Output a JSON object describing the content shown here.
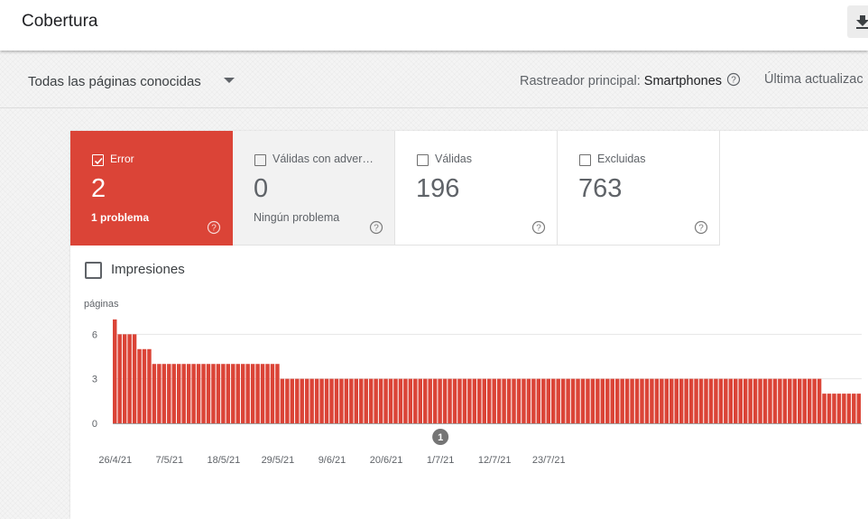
{
  "header": {
    "title": "Cobertura"
  },
  "filter": {
    "selected": "Todas las páginas conocidas",
    "crawler_label": "Rastreador principal:",
    "crawler_value": "Smartphones",
    "last_update": "Última actualizac"
  },
  "cards": [
    {
      "label": "Error",
      "count": "2",
      "sub": "1 problema",
      "checked": true
    },
    {
      "label": "Válidas con adver…",
      "count": "0",
      "sub": "Ningún problema",
      "checked": false
    },
    {
      "label": "Válidas",
      "count": "196",
      "sub": "",
      "checked": false
    },
    {
      "label": "Excluidas",
      "count": "763",
      "sub": "",
      "checked": false
    }
  ],
  "impressions": {
    "label": "Impresiones"
  },
  "chart_data": {
    "type": "bar",
    "ylabel": "páginas",
    "yticks": [
      0,
      3,
      6,
      9
    ],
    "ylim": [
      0,
      9
    ],
    "grid": true,
    "color": "#db4437",
    "xtick_labels": [
      "26/4/21",
      "7/5/21",
      "18/5/21",
      "29/5/21",
      "9/6/21",
      "20/6/21",
      "1/7/21",
      "12/7/21",
      "23/7/21"
    ],
    "xtick_index": [
      0,
      11,
      22,
      33,
      44,
      55,
      66,
      77,
      88
    ],
    "annotation": {
      "label": "1",
      "index": 66
    },
    "values": [
      7,
      6,
      6,
      6,
      6,
      5,
      5,
      5,
      4,
      4,
      4,
      4,
      4,
      4,
      4,
      4,
      4,
      4,
      4,
      4,
      4,
      4,
      4,
      4,
      4,
      4,
      4,
      4,
      4,
      4,
      4,
      4,
      4,
      4,
      3,
      3,
      3,
      3,
      3,
      3,
      3,
      3,
      3,
      3,
      3,
      3,
      3,
      3,
      3,
      3,
      3,
      3,
      3,
      3,
      3,
      3,
      3,
      3,
      3,
      3,
      3,
      3,
      3,
      3,
      3,
      3,
      3,
      3,
      3,
      3,
      3,
      3,
      3,
      3,
      3,
      3,
      3,
      3,
      3,
      3,
      3,
      3,
      3,
      3,
      3,
      3,
      3,
      3,
      3,
      3,
      3,
      3,
      3,
      3,
      3,
      3,
      3,
      3,
      3,
      3,
      3,
      3,
      3,
      3,
      3,
      3,
      3,
      3,
      3,
      3,
      3,
      3,
      3,
      3,
      3,
      3,
      3,
      3,
      3,
      3,
      3,
      3,
      3,
      3,
      3,
      3,
      3,
      3,
      3,
      3,
      3,
      3,
      3,
      3,
      3,
      3,
      3,
      3,
      3,
      3,
      3,
      3,
      3,
      3,
      2,
      2,
      2,
      2,
      2,
      2,
      2,
      2
    ]
  }
}
